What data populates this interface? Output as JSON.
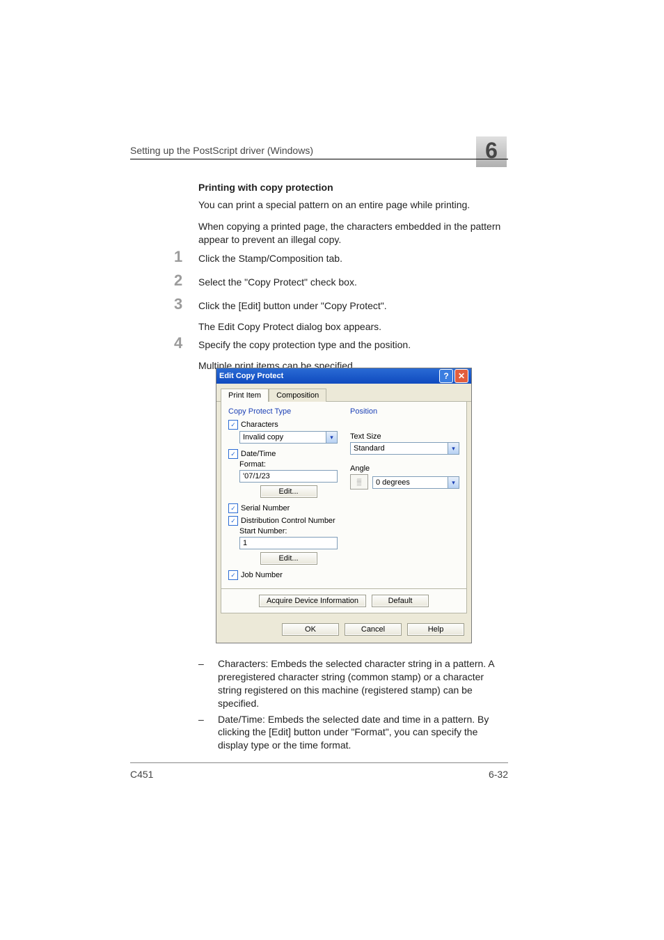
{
  "header": {
    "running_title": "Setting up the PostScript driver (Windows)",
    "chapter_number": "6"
  },
  "section": {
    "heading": "Printing with copy protection",
    "p1": "You can print a special pattern on an entire page while printing.",
    "p2": "When copying a printed page, the characters embedded in the pattern appear to prevent an illegal copy."
  },
  "steps": {
    "s1": {
      "num": "1",
      "text": "Click the Stamp/Composition tab."
    },
    "s2": {
      "num": "2",
      "text": "Select the \"Copy Protect\" check box."
    },
    "s3": {
      "num": "3",
      "text": "Click the [Edit] button under \"Copy Protect\".",
      "sub": "The Edit Copy Protect dialog box appears."
    },
    "s4": {
      "num": "4",
      "text": "Specify the copy protection type and the position.",
      "sub": "Multiple print items can be specified."
    }
  },
  "dialog": {
    "title": "Edit Copy Protect",
    "tabs": {
      "active": "Print Item",
      "other": "Composition"
    },
    "left": {
      "group_label": "Copy Protect Type",
      "characters": {
        "label": "Characters",
        "value": "Invalid copy"
      },
      "datetime": {
        "label": "Date/Time",
        "format_label": "Format:",
        "format_value": "'07/1/23",
        "edit_btn": "Edit..."
      },
      "serial_label": "Serial Number",
      "dcn": {
        "label": "Distribution Control Number",
        "start_label": "Start Number:",
        "start_value": "1",
        "edit_btn": "Edit..."
      },
      "job_label": "Job Number"
    },
    "right": {
      "group_label": "Position",
      "text_size_label": "Text Size",
      "text_size_value": "Standard",
      "angle_label": "Angle",
      "angle_value": "0 degrees"
    },
    "panel_buttons": {
      "acquire": "Acquire Device Information",
      "default": "Default"
    },
    "bottom_buttons": {
      "ok": "OK",
      "cancel": "Cancel",
      "help": "Help"
    }
  },
  "bullets": {
    "b1": "Characters: Embeds the selected character string in a pattern. A preregistered character string (common stamp) or a character string registered on this machine (registered stamp) can be specified.",
    "b2": "Date/Time: Embeds the selected date and time in a pattern. By clicking the [Edit] button under \"Format\", you can specify the display type or the time format."
  },
  "footer": {
    "model": "C451",
    "page": "6-32"
  },
  "icons": {
    "check": "✓",
    "dropdown": "▾",
    "help": "?",
    "close": "✕",
    "dash": "–"
  }
}
